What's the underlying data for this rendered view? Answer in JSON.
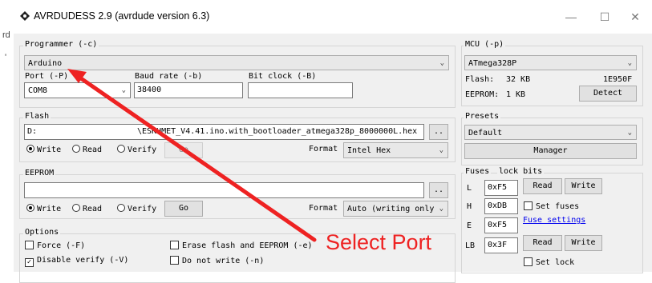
{
  "window": {
    "title": "AVRDUDESS 2.9 (avrdude version 6.3)",
    "minimize_glyph": "—",
    "maximize_glyph": "☐",
    "close_glyph": "✕"
  },
  "left_strip": {
    "line1": "rd",
    "line2": "'"
  },
  "programmer": {
    "label": "Programmer (-c)",
    "value": "Arduino",
    "port_label": "Port (-P)",
    "port_value": "COM8",
    "baud_label": "Baud rate (-b)",
    "baud_value": "38400",
    "bitclock_label": "Bit clock (-B)",
    "bitclock_value": ""
  },
  "flash": {
    "label": "Flash",
    "path_start": "D:",
    "path_end": "\\ESKHMET_V4.41.ino.with_bootloader_atmega328p_8000000L.hex",
    "browse": "..",
    "write": "Write",
    "read": "Read",
    "verify": "Verify",
    "go": "Go",
    "format_label": "Format",
    "format_value": "Intel Hex"
  },
  "eeprom": {
    "label": "EEPROM",
    "path": "",
    "browse": "..",
    "write": "Write",
    "read": "Read",
    "verify": "Verify",
    "go": "Go",
    "format_label": "Format",
    "format_value": "Auto (writing only"
  },
  "options": {
    "label": "Options",
    "force": "Force (-F)",
    "disable_verify": "Disable verify (-V)",
    "erase": "Erase flash and EEPROM (-e)",
    "do_not_write": "Do not write (-n)"
  },
  "mcu": {
    "label": "MCU (-p)",
    "value": "ATmega328P",
    "flash_label": "Flash:",
    "flash_size": "32 KB",
    "signature": "1E950F",
    "eeprom_label": "EEPROM:",
    "eeprom_size": "1 KB",
    "detect": "Detect"
  },
  "presets": {
    "label": "Presets",
    "value": "Default",
    "manager": "Manager"
  },
  "fuses": {
    "label": "Fuses",
    "lockbits_label": "lock bits",
    "l_label": "L",
    "l_value": "0xF5",
    "h_label": "H",
    "h_value": "0xDB",
    "e_label": "E",
    "e_value": "0xF5",
    "lb_label": "LB",
    "lb_value": "0x3F",
    "read": "Read",
    "write": "Write",
    "set_fuses": "Set fuses",
    "fuse_settings": "Fuse settings",
    "set_lock": "Set lock"
  },
  "annotation": {
    "text": "Select Port",
    "color": "#ee2222"
  }
}
